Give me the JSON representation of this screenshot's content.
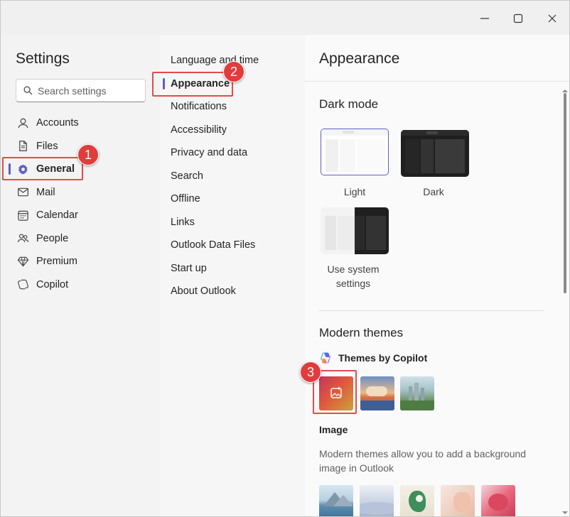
{
  "window": {
    "controls": [
      "minimize",
      "maximize",
      "close"
    ]
  },
  "left_nav": {
    "title": "Settings",
    "search_placeholder": "Search settings",
    "items": [
      {
        "label": "Accounts",
        "icon": "person-icon"
      },
      {
        "label": "Files",
        "icon": "document-icon"
      },
      {
        "label": "General",
        "icon": "gear-icon",
        "active": true
      },
      {
        "label": "Mail",
        "icon": "mail-icon"
      },
      {
        "label": "Calendar",
        "icon": "calendar-icon"
      },
      {
        "label": "People",
        "icon": "people-icon"
      },
      {
        "label": "Premium",
        "icon": "diamond-icon"
      },
      {
        "label": "Copilot",
        "icon": "copilot-icon"
      }
    ]
  },
  "sub_nav": {
    "items": [
      {
        "label": "Language and time"
      },
      {
        "label": "Appearance",
        "active": true
      },
      {
        "label": "Notifications"
      },
      {
        "label": "Accessibility"
      },
      {
        "label": "Privacy and data"
      },
      {
        "label": "Search"
      },
      {
        "label": "Offline"
      },
      {
        "label": "Links"
      },
      {
        "label": "Outlook Data Files"
      },
      {
        "label": "Start up"
      },
      {
        "label": "About Outlook"
      }
    ]
  },
  "pane": {
    "title": "Appearance",
    "dark_mode": {
      "heading": "Dark mode",
      "options": [
        {
          "label": "Light",
          "selected": true
        },
        {
          "label": "Dark"
        },
        {
          "label": "Use system settings"
        }
      ]
    },
    "modern_themes": {
      "heading": "Modern themes",
      "copilot_label": "Themes by Copilot",
      "image_label": "Image",
      "image_desc": "Modern themes allow you to add a background image in Outlook"
    }
  },
  "callouts": [
    "1",
    "2",
    "3"
  ],
  "colors": {
    "accent": "#5b5fc7",
    "callout": "#e03c3c"
  }
}
